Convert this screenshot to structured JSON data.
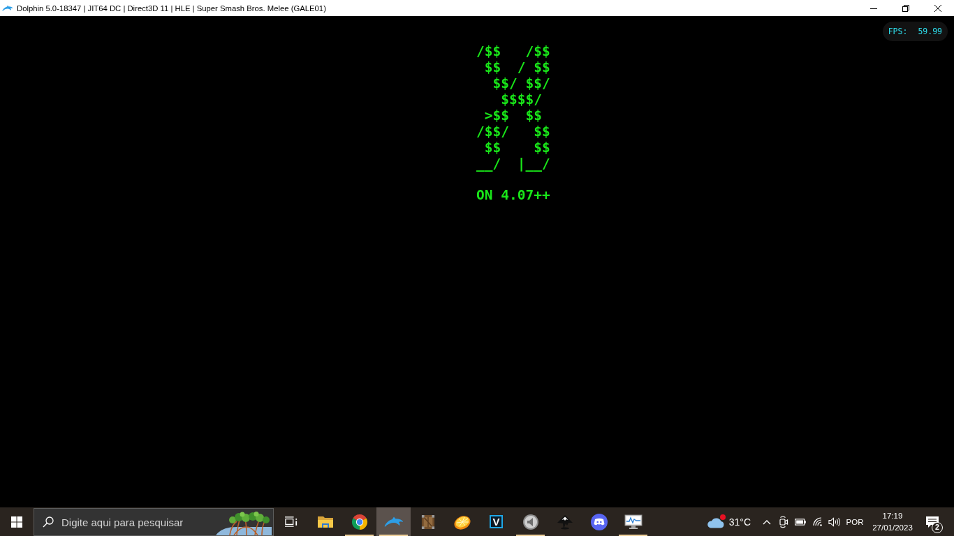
{
  "window": {
    "title": "Dolphin 5.0-18347 | JIT64 DC | Direct3D 11 | HLE | Super Smash Bros. Melee (GALE01)"
  },
  "game_screen": {
    "logo_lines": [
      "/$$   /$$",
      " $$  / $$",
      "  $$/ $$/",
      "   $$$$/",
      " >$$  $$",
      "/$$/   $$",
      " $$    $$",
      "__/  |__/"
    ],
    "version": "ON 4.07++",
    "fps": {
      "label": "FPS:",
      "value": "59.99"
    }
  },
  "taskbar": {
    "search": {
      "placeholder": "Digite aqui para pesquisar"
    },
    "apps": [
      {
        "kind": "folder",
        "running": false,
        "selected": false
      },
      {
        "kind": "browser",
        "running": true,
        "selected": false
      },
      {
        "kind": "dolphin",
        "running": true,
        "selected": true
      },
      {
        "kind": "crate",
        "running": false,
        "selected": false
      },
      {
        "kind": "orange",
        "running": false,
        "selected": false
      },
      {
        "kind": "letter_tile",
        "label": "V",
        "running": false,
        "selected": false
      },
      {
        "kind": "speaker",
        "running": true,
        "selected": false
      },
      {
        "kind": "ink",
        "running": false,
        "selected": false
      },
      {
        "kind": "gamepad",
        "running": false,
        "selected": false
      },
      {
        "kind": "monitor",
        "running": true,
        "selected": false
      }
    ],
    "weather": {
      "temperature": "31°C",
      "alert": true
    },
    "language": "POR",
    "clock": {
      "time": "17:19",
      "date": "27/01/2023"
    },
    "notifications": {
      "count": "2"
    }
  }
}
